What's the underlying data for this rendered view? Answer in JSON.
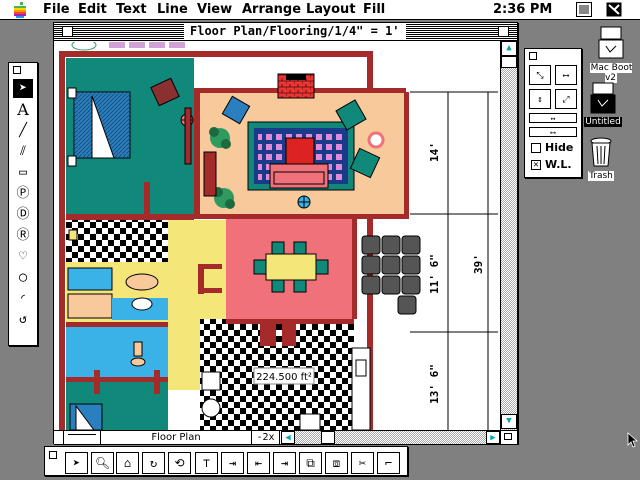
{
  "menubar": {
    "apple_icon": "apple-icon",
    "items": [
      "File",
      "Edit",
      "Text",
      "Line",
      "View",
      "Arrange",
      "Layout",
      "Fill"
    ],
    "time": "2:36 PM"
  },
  "window": {
    "title": "Floor Plan/Flooring/1/4\" = 1'",
    "view_name": "Floor Plan",
    "zoom": "-2x"
  },
  "plan": {
    "area_label": "224.500 ft²",
    "dimensions": [
      "14'",
      "39'",
      "11' 6\"",
      "13' 6\""
    ]
  },
  "dimension_palette": {
    "hide_label": "Hide",
    "wl_label": "W.L.",
    "hide_checked": false,
    "wl_checked": true
  },
  "desktop": {
    "icons": [
      {
        "label": "Mac Boot v2",
        "icon": "hard-disk-icon",
        "selected": false
      },
      {
        "label": "Untitled",
        "icon": "hard-disk-icon",
        "selected": true
      },
      {
        "label": "Trash",
        "icon": "trash-icon",
        "selected": false
      }
    ]
  },
  "colors": {
    "wall": "#a52a2a",
    "teal": "#10897a",
    "green": "#2e9a60",
    "peach": "#f8c99a",
    "pink": "#f0717a",
    "yellow": "#f5e67a",
    "blue": "#3ab2e8",
    "cyan": "#22b8c8"
  }
}
